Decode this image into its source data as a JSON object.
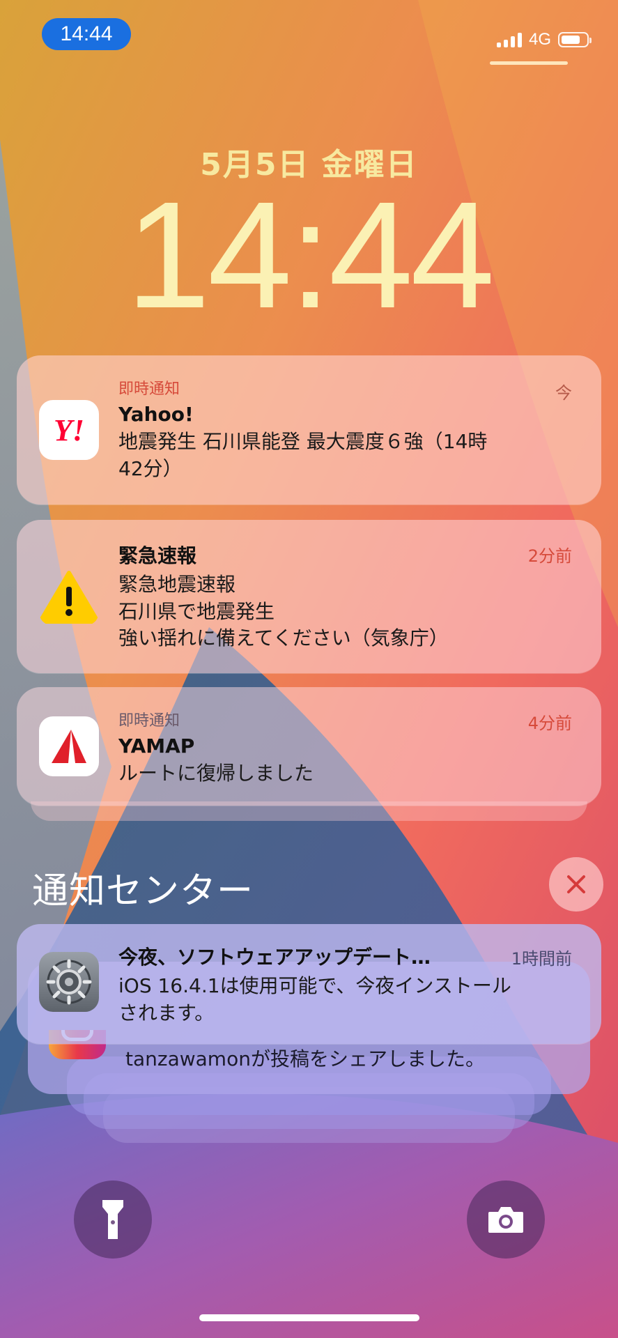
{
  "status_bar": {
    "time": "14:44",
    "network": "4G",
    "battery_level_pct": 75
  },
  "lock_screen": {
    "date": "5月5日 金曜日",
    "time": "14:44"
  },
  "notifications": [
    {
      "app": "Yahoo!",
      "icon": "yahoo-icon",
      "icon_text": "Y!",
      "category": "即時通知",
      "title": "Yahoo!",
      "body": [
        "地震発生 石川県能登 最大震度６強（14時",
        "42分）"
      ],
      "time": "今"
    },
    {
      "app": "緊急速報",
      "icon": "warning-icon",
      "title": "緊急速報",
      "body": [
        "緊急地震速報",
        "石川県で地震発生",
        "強い揺れに備えてください（気象庁）"
      ],
      "time": "2分前"
    },
    {
      "app": "YAMAP",
      "icon": "yamap-icon",
      "category": "即時通知",
      "title": "YAMAP",
      "body": [
        "ルートに復帰しました"
      ],
      "time": "4分前"
    }
  ],
  "notification_center": {
    "header": "通知センター",
    "clear_icon": "close-icon",
    "stack": [
      {
        "app": "Settings",
        "icon": "settings-gear-icon",
        "title": "今夜、ソフトウェアアップデート…",
        "body": [
          "iOS 16.4.1は使用可能で、今夜インストール",
          "されます。"
        ],
        "time": "1時間前"
      },
      {
        "app": "Instagram",
        "icon": "instagram-icon",
        "body": "tanzawamonが投稿をシェアしました。"
      }
    ]
  },
  "quick_actions": {
    "flashlight_icon": "flashlight-icon",
    "camera_icon": "camera-icon"
  },
  "colors": {
    "yahoo_red": "#ff0033",
    "warning_yellow": "#ffcc00",
    "time_red": "#d64a3a",
    "accent_blue": "#1a6fe0"
  }
}
